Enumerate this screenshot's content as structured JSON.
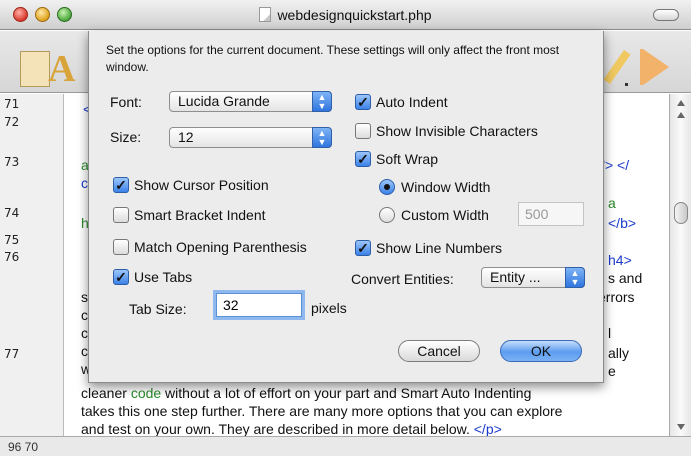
{
  "window": {
    "title": "webdesignquickstart.php"
  },
  "editor": {
    "line_numbers": [
      "71",
      "72",
      "73",
      "74",
      "75",
      "76",
      "77"
    ],
    "visible_text": {
      "l71_frag": "<",
      "l73_frag_a": "a",
      "l73_frag_c": "c",
      "l73_right": "\"> </",
      "l74_frag": "h",
      "l74_right_a": "a",
      "l74_right_b": "</b>",
      "l76_right_a": "h4>",
      "l76_right_b": "s and",
      "l76_right_c": "errors",
      "left_s": "s",
      "left_c1": "c",
      "left_c2": "c",
      "left_c3": "c",
      "left_w": "w",
      "right_l": "l",
      "right_ally": "ally",
      "right_e": "e",
      "line_cleaner_1": "cleaner ",
      "line_cleaner_code": "code",
      "line_cleaner_2": " without a lot of effort on your part and Smart Auto Indenting",
      "line_takes": "takes this one step further. There are many more options that you can explore",
      "line_test": "and test on your own. They are described in more detail below. ",
      "line_test_tag": "</p>"
    },
    "status": "96 70"
  },
  "sheet": {
    "intro": "Set the options for the current document. These settings will only affect the front most window.",
    "font": {
      "label": "Font:",
      "value": "Lucida Grande"
    },
    "size": {
      "label": "Size:",
      "value": "12"
    },
    "show_cursor_position": {
      "label": "Show Cursor Position",
      "checked": true
    },
    "smart_bracket_indent": {
      "label": "Smart Bracket Indent",
      "checked": false
    },
    "match_opening_parenthesis": {
      "label": "Match Opening Parenthesis",
      "checked": false
    },
    "use_tabs": {
      "label": "Use Tabs",
      "checked": true
    },
    "tab_size": {
      "label": "Tab Size:",
      "value": "32",
      "unit": "pixels"
    },
    "auto_indent": {
      "label": "Auto Indent",
      "checked": true
    },
    "show_invisible_characters": {
      "label": "Show Invisible Characters",
      "checked": false
    },
    "soft_wrap": {
      "label": "Soft Wrap",
      "checked": true
    },
    "window_width": {
      "label": "Window Width",
      "selected": true
    },
    "custom_width": {
      "label": "Custom Width",
      "selected": false,
      "value": "500"
    },
    "show_line_numbers": {
      "label": "Show Line Numbers",
      "checked": true
    },
    "convert_entities": {
      "label": "Convert Entities:",
      "value": "Entity ..."
    },
    "cancel_label": "Cancel",
    "ok_label": "OK"
  },
  "colors": {
    "accent": "#3c82e8",
    "code_green": "#2a8a2a",
    "code_blue": "#1a3acb"
  }
}
